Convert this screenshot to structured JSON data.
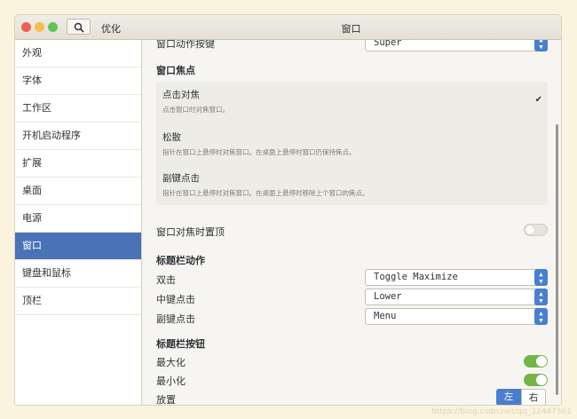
{
  "titlebar": {
    "app_name": "优化",
    "window_title": "窗口"
  },
  "sidebar": {
    "items": [
      {
        "label": "外观"
      },
      {
        "label": "字体"
      },
      {
        "label": "工作区"
      },
      {
        "label": "开机启动程序"
      },
      {
        "label": "扩展"
      },
      {
        "label": "桌面"
      },
      {
        "label": "电源"
      },
      {
        "label": "窗口",
        "active": true
      },
      {
        "label": "键盘和鼠标"
      },
      {
        "label": "顶栏"
      }
    ]
  },
  "window_action_key": {
    "label": "窗口动作按键",
    "value": "Super"
  },
  "focus": {
    "section": "窗口焦点",
    "options": [
      {
        "title": "点击对焦",
        "desc": "点击窗口时对焦窗口。",
        "selected": true
      },
      {
        "title": "松散",
        "desc": "指针在窗口上悬停时对焦窗口。在桌面上悬停时窗口仍保持焦点。"
      },
      {
        "title": "副键点击",
        "desc": "指针在窗口上悬停时对焦窗口。在桌面上悬停时移除上个窗口的焦点。"
      }
    ],
    "raise_label": "窗口对焦时置顶",
    "raise_on": false
  },
  "titlebar_actions": {
    "section": "标题栏动作",
    "double_click": {
      "label": "双击",
      "value": "Toggle Maximize"
    },
    "middle_click": {
      "label": "中键点击",
      "value": "Lower"
    },
    "secondary_click": {
      "label": "副键点击",
      "value": "Menu"
    }
  },
  "titlebar_buttons": {
    "section": "标题栏按钮",
    "maximize": {
      "label": "最大化",
      "on": true
    },
    "minimize": {
      "label": "最小化",
      "on": true
    },
    "placement": {
      "label": "放置",
      "left": "左",
      "right": "右",
      "selected": "左"
    }
  },
  "watermark": "https://blog.csdn.net/qq_32447361",
  "colors": {
    "accent": "#4a7fcf",
    "selection": "#4a73b7",
    "switch_on": "#73b548"
  }
}
